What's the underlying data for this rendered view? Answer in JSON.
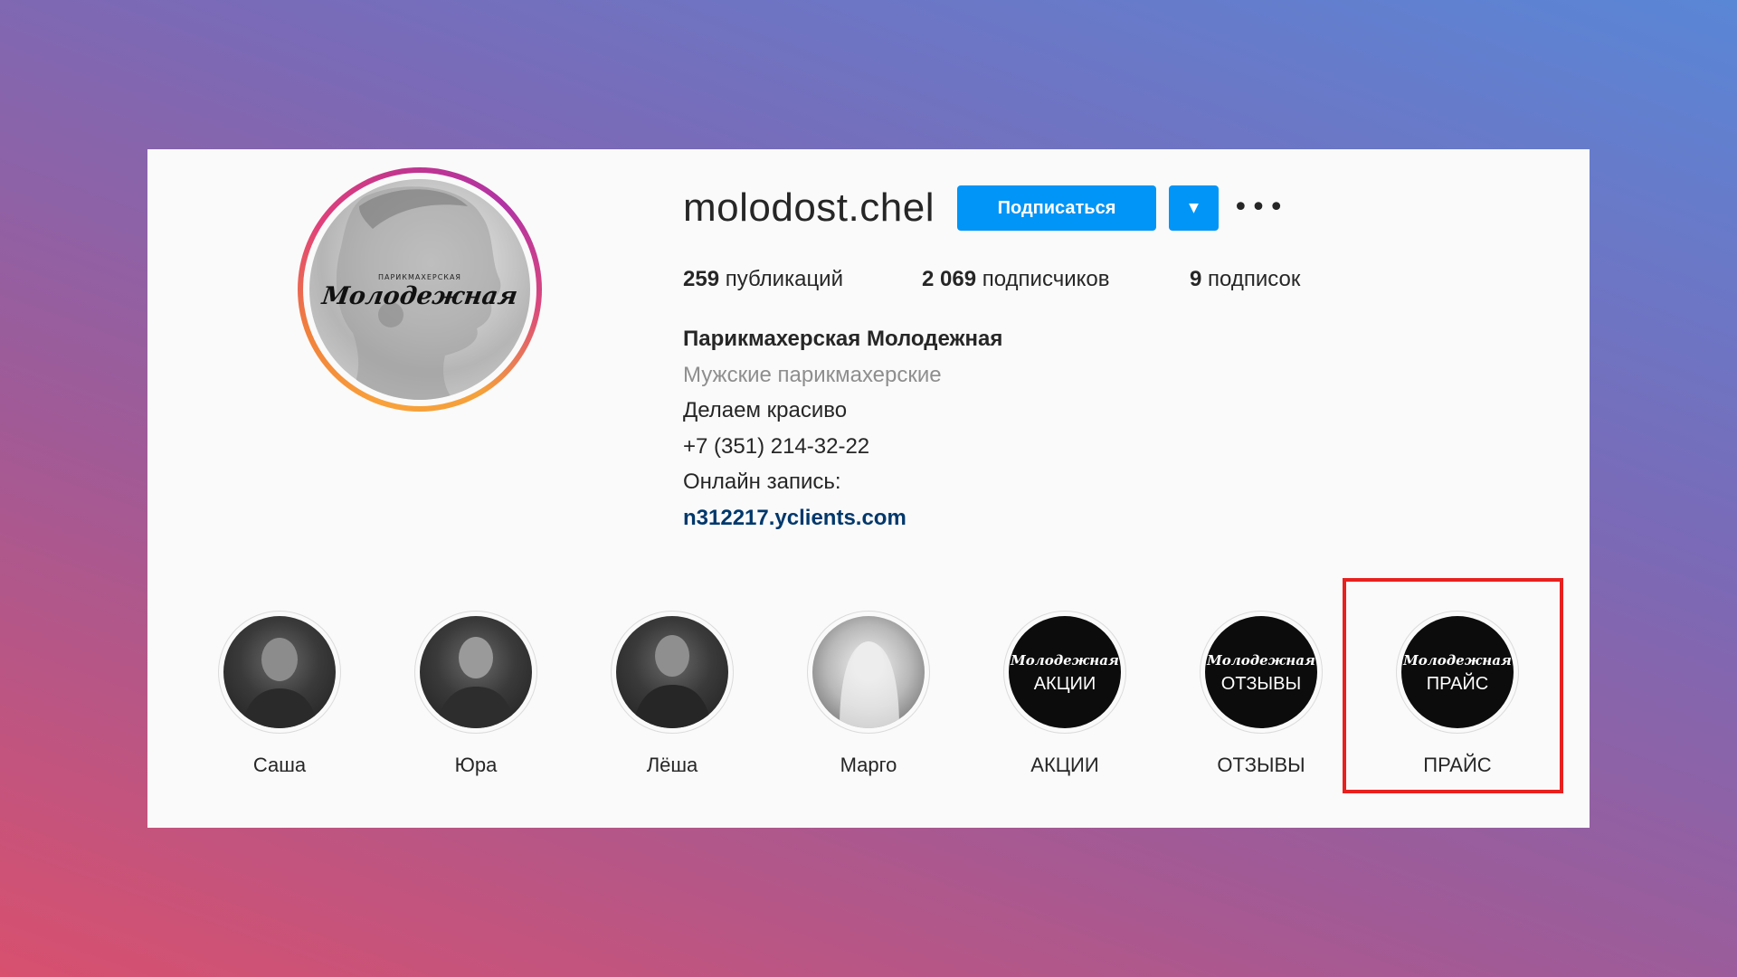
{
  "profile": {
    "username": "molodost.chel",
    "avatar_brand_small": "ПАРИКМАХЕРСКАЯ",
    "avatar_brand_script": "Молодежная"
  },
  "actions": {
    "follow_label": "Подписаться",
    "dropdown_icon": "▼",
    "more_icon": "•••"
  },
  "stats": {
    "posts_count": "259",
    "posts_label": "публикаций",
    "followers_count": "2 069",
    "followers_label": "подписчиков",
    "following_count": "9",
    "following_label": "подписок"
  },
  "bio": {
    "name": "Парикмахерская Молодежная",
    "category": "Мужские парикмахерские",
    "line1": "Делаем красиво",
    "phone": "+7 (351) 214-32-22",
    "booking": "Онлайн запись:",
    "link": "n312217.yclients.com"
  },
  "highlights": [
    {
      "label": "Саша",
      "type": "photo"
    },
    {
      "label": "Юра",
      "type": "photo"
    },
    {
      "label": "Лёша",
      "type": "photo"
    },
    {
      "label": "Марго",
      "type": "photo-light"
    },
    {
      "label": "АКЦИИ",
      "type": "dark",
      "script": "Молодежная",
      "word": "АКЦИИ"
    },
    {
      "label": "ОТЗЫВЫ",
      "type": "dark",
      "script": "Молодежная",
      "word": "ОТЗЫВЫ"
    },
    {
      "label": "ПРАЙС",
      "type": "dark",
      "script": "Молодежная",
      "word": "ПРАЙС"
    }
  ],
  "colors": {
    "accent": "#0095f6",
    "highlight_box": "#e8201e",
    "link": "#00376b"
  }
}
